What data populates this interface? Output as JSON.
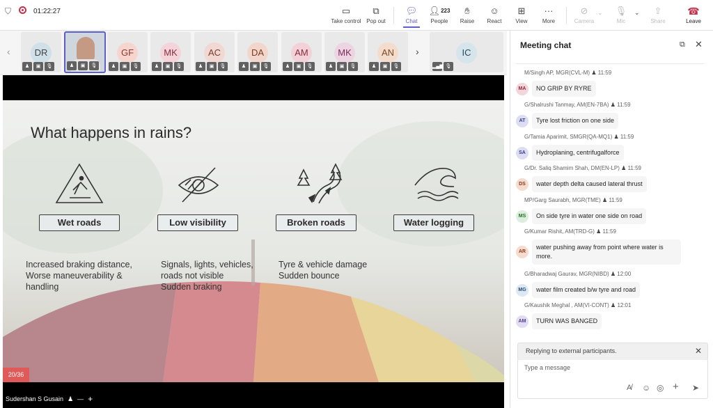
{
  "meeting": {
    "timer": "01:22:27"
  },
  "toolbar": {
    "take_control": "Take control",
    "pop_out": "Pop out",
    "chat": "Chat",
    "people": "People",
    "people_count": "223",
    "raise": "Raise",
    "react": "React",
    "view": "View",
    "more": "More",
    "camera": "Camera",
    "mic": "Mic",
    "share": "Share",
    "leave": "Leave"
  },
  "participants": [
    {
      "initials": "DR",
      "color": "#cfe0e8",
      "text": "#444"
    },
    {
      "initials": "",
      "color": "#ddd",
      "text": "#444"
    },
    {
      "initials": "GF",
      "color": "#f6d5cf",
      "text": "#8a3a2a"
    },
    {
      "initials": "MK",
      "color": "#f4d4d9",
      "text": "#8a2d3e"
    },
    {
      "initials": "AC",
      "color": "#f1d8d2",
      "text": "#7a3a2a"
    },
    {
      "initials": "DA",
      "color": "#f2d6cc",
      "text": "#7a3a22"
    },
    {
      "initials": "AM",
      "color": "#f3d1d8",
      "text": "#8a2a3a"
    },
    {
      "initials": "MK",
      "color": "#ecd4e2",
      "text": "#7a2a5a"
    },
    {
      "initials": "AN",
      "color": "#f3dccb",
      "text": "#7a4a22"
    },
    {
      "initials": "IC",
      "color": "#d6e4ec",
      "text": "#2a4a5a"
    }
  ],
  "slide": {
    "title": "What happens in rains?",
    "page": "20/36",
    "items": [
      {
        "label": "Wet roads",
        "desc": "Increased braking distance,\nWorse maneuverability &\nhandling"
      },
      {
        "label": "Low visibility",
        "desc": "Signals, lights, vehicles,\nroads not visible\nSudden braking"
      },
      {
        "label": "Broken roads",
        "desc": "Tyre & vehicle damage\nSudden bounce"
      },
      {
        "label": "Water logging",
        "desc": ""
      }
    ]
  },
  "presenter": {
    "name": "Sudershan S Gusain"
  },
  "chat": {
    "title": "Meeting chat",
    "banner": "Replying to external participants.",
    "input_placeholder": "Type a message",
    "messages": [
      {
        "sender": "M/Singh AP, MGR(CVL-M)",
        "time": "11:59",
        "initials": "MA",
        "color": "#f3d6dc",
        "text_color": "#8a2a3a",
        "text": "NO GRIP BY RYRE"
      },
      {
        "sender": "G/Shalrushi Tanmay, AM(EN-7BA)",
        "time": "11:59",
        "initials": "AT",
        "color": "#dcdcf3",
        "text_color": "#3a3a8a",
        "text": "Tyre lost friction on one side"
      },
      {
        "sender": "G/Tamia Aparimit, SMGR(QA-MQ1)",
        "time": "11:59",
        "initials": "SA",
        "color": "#dcdcf3",
        "text_color": "#3a3a8a",
        "text": "Hydroplaning, centrifugalforce"
      },
      {
        "sender": "G/Dr. Saliq Shamim Shah, DM(EN-LP)",
        "time": "11:59",
        "initials": "DS",
        "color": "#f6dccf",
        "text_color": "#8a3a1a",
        "text": "water depth delta caused lateral thrust"
      },
      {
        "sender": "MP/Garg Saurabh, MGR(TME)",
        "time": "11:59",
        "initials": "MS",
        "color": "#dcefdc",
        "text_color": "#2a6a2a",
        "text": "On side tyre in water one side on road"
      },
      {
        "sender": "G/Kumar Rishit, AM(TRD-G)",
        "time": "11:59",
        "initials": "AR",
        "color": "#f6dccf",
        "text_color": "#8a3a1a",
        "text": "water pushing away from point where water is\nmore."
      },
      {
        "sender": "G/Bharadwaj Gaurav, MGR(NIBD)",
        "time": "12:00",
        "initials": "MG",
        "color": "#dce8f3",
        "text_color": "#2a4a6a",
        "text": "water film created b/w tyre and road"
      },
      {
        "sender": "G/Kaushik Meghal , AM(VI-CONT)",
        "time": "12:01",
        "initials": "AM",
        "color": "#e3dcf3",
        "text_color": "#4a3a8a",
        "text": "TURN WAS BANGED"
      }
    ]
  }
}
